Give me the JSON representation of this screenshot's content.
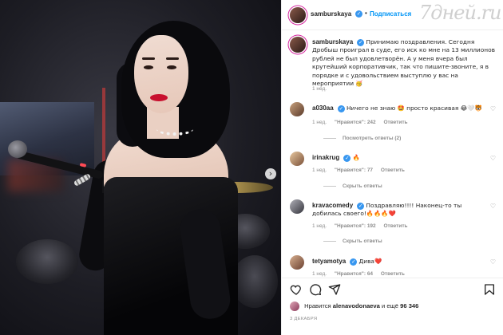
{
  "post": {
    "author": "samburskaya",
    "follow_label": "Подписаться",
    "separator": "•",
    "verified_mark": "✓",
    "watermark": "7дней.ru",
    "next_icon": "chevron-right-icon"
  },
  "caption": {
    "username": "samburskaya",
    "text": "Принимаю поздравления. Сегодня Дробыш проиграл в суде, его иск ко мне на 13 миллионов рублей не был удовлетворён. А у меня вчера был крутейший корпоративчик, так что пишите-звоните, я в порядке и с удовольствием выступлю у вас на мероприятии 🥳",
    "time": "1 нед."
  },
  "comments": [
    {
      "username": "a030aa",
      "text": "Ничего не знаю 🤩 просто красивая 😂🤍🐯",
      "time": "1 нед.",
      "likes": "\"Нравится\": 242",
      "reply": "Ответить",
      "thread": "Посмотреть ответы (2)"
    },
    {
      "username": "irinakrug",
      "text": "🔥",
      "time": "1 нед.",
      "likes": "\"Нравится\": 77",
      "reply": "Ответить",
      "thread": "Скрыть ответы"
    },
    {
      "username": "kravacomedy",
      "text": "Поздравляю!!!! Наконец-то ты добилась своего!🔥🔥🔥❤️",
      "time": "1 нед.",
      "likes": "\"Нравится\": 192",
      "reply": "Ответить",
      "thread": "Скрыть ответы"
    },
    {
      "username": "tetyamotya",
      "text": "Дива❤️",
      "time": "1 нед.",
      "likes": "\"Нравится\": 64",
      "reply": "Ответить"
    }
  ],
  "likes": {
    "prefix": "Нравится",
    "user": "alenavodonaeva",
    "middle": "и ещё",
    "count": "96 346"
  },
  "date": "3 ДЕКАБРЯ",
  "colors": {
    "link": "#0095f6",
    "verified": "#3897f0",
    "secondary": "#8e8e8e",
    "lips": "#c8102e"
  },
  "icons": [
    "heart-icon",
    "comment-icon",
    "share-icon",
    "bookmark-icon",
    "more-icon"
  ]
}
